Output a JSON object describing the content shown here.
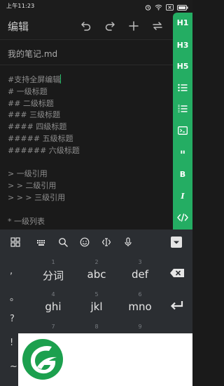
{
  "status_bar": {
    "time": "上午11:23"
  },
  "app_bar": {
    "title": "编辑"
  },
  "document": {
    "filename": "我的笔记.md"
  },
  "editor": {
    "lines": [
      "#支持全屏编辑",
      "# 一级标题",
      "## 二级标题",
      "### 三级标题",
      "#### 四级标题",
      "##### 五级标题",
      "###### 六级标题",
      "",
      "> 一级引用",
      "> > 二级引用",
      "> > > 三级引用",
      "",
      "* 一级列表"
    ]
  },
  "sidebar": {
    "h1": "H1",
    "h3": "H3",
    "h5": "H5",
    "quote": "\"",
    "bold": "B",
    "italic": "I"
  },
  "keyboard": {
    "side_keys": [
      ",",
      "。",
      "?",
      "!",
      "~"
    ],
    "rows": [
      [
        {
          "num": "1",
          "main": "分词"
        },
        {
          "num": "2",
          "main": "abc"
        },
        {
          "num": "3",
          "main": "def"
        }
      ],
      [
        {
          "num": "4",
          "main": "ghi"
        },
        {
          "num": "5",
          "main": "jkl"
        },
        {
          "num": "6",
          "main": "mno"
        }
      ],
      [
        {
          "num": "7",
          "main": ""
        },
        {
          "num": "8",
          "main": ""
        },
        {
          "num": "9",
          "main": ""
        }
      ]
    ]
  },
  "colors": {
    "accent": "#24ad63",
    "background": "#1a1a1a",
    "keyboard": "#2b2e32",
    "logo_green": "#1ca04e"
  }
}
